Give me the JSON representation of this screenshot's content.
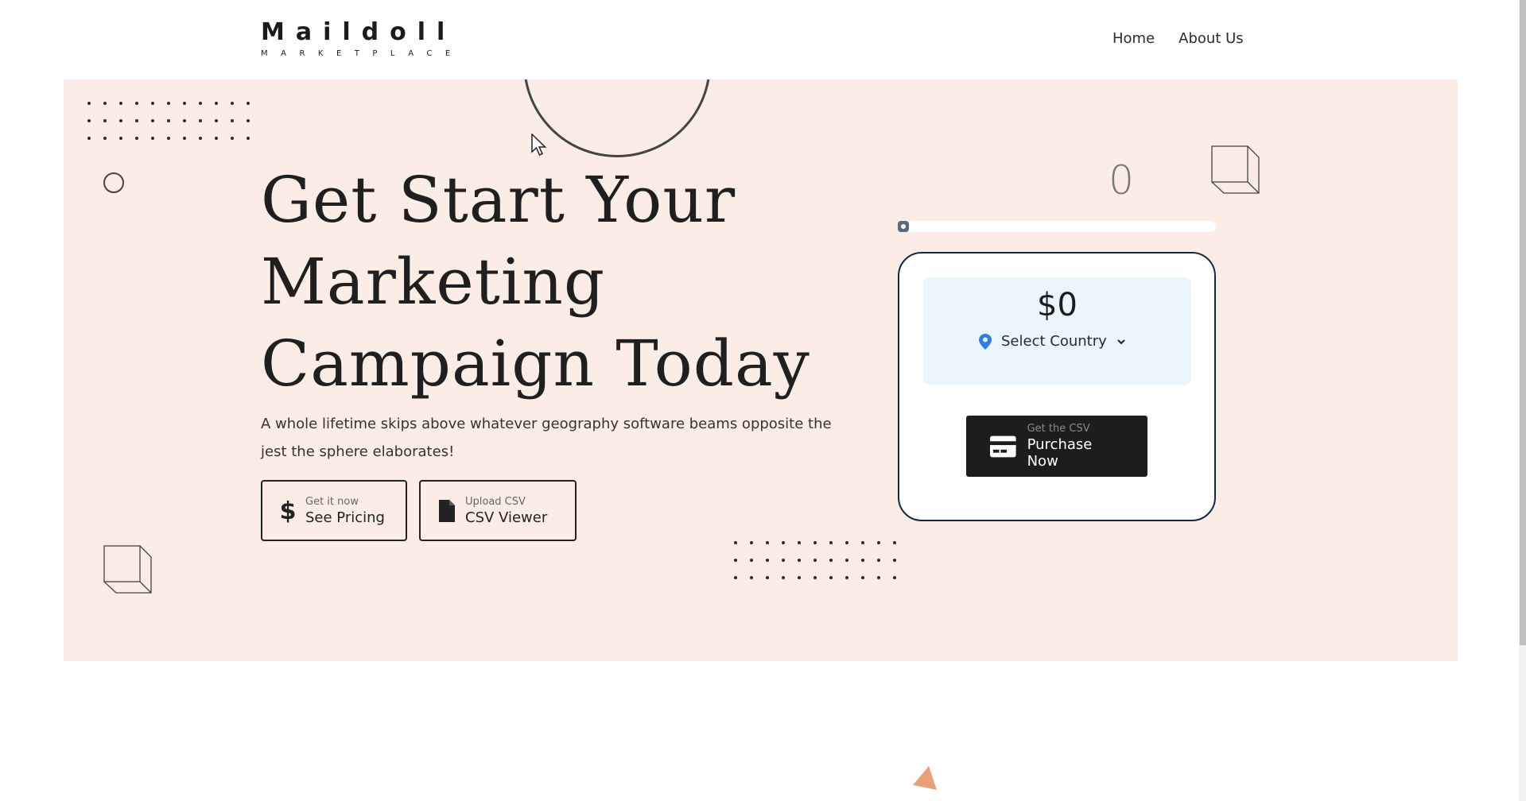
{
  "header": {
    "logo_main": "Maildoll",
    "logo_sub": "MARKETPLACE",
    "nav": [
      {
        "label": "Home"
      },
      {
        "label": "About Us"
      }
    ]
  },
  "hero": {
    "headline": "Get Start Your Marketing Campaign Today",
    "subtext": "A whole lifetime skips above whatever geography software beams opposite the jest the sphere elaborates!",
    "buttons": {
      "pricing": {
        "small": "Get it now",
        "big": "See Pricing",
        "icon": "dollar-icon"
      },
      "csv": {
        "small": "Upload CSV",
        "big": "CSV Viewer",
        "icon": "file-icon"
      }
    }
  },
  "widget": {
    "counter": "0",
    "slider_value": 0,
    "price": "$0",
    "country_select": {
      "label": "Select Country",
      "icon": "location-pin-icon"
    },
    "purchase": {
      "small": "Get the CSV",
      "big": "Purchase Now",
      "icon": "credit-card-icon"
    }
  },
  "colors": {
    "hero_bg": "#fbede5",
    "price_box_bg": "#eaf5fd",
    "card_border": "#122740",
    "purchase_bg": "#1d1d1d",
    "pin_blue": "#2f7de1",
    "triangle": "#e8a07a"
  }
}
